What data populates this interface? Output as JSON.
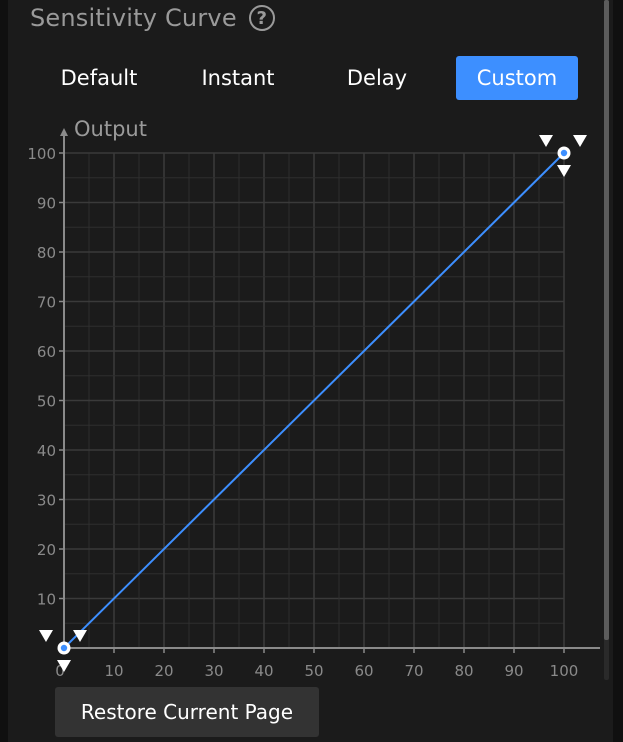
{
  "header": {
    "title": "Sensitivity Curve",
    "help_icon": "question-circle-icon"
  },
  "tabs": [
    {
      "label": "Default",
      "active": false
    },
    {
      "label": "Instant",
      "active": false
    },
    {
      "label": "Delay",
      "active": false
    },
    {
      "label": "Custom",
      "active": true
    }
  ],
  "colors": {
    "accent": "#3d8fff",
    "curve": "#3d8fff",
    "grid": "#3a3a3a",
    "axis": "#8a8a8a"
  },
  "chart_data": {
    "type": "line",
    "title": "",
    "ylabel": "Output",
    "xlabel": "",
    "xlim": [
      0,
      100
    ],
    "ylim": [
      0,
      100
    ],
    "x_ticks": [
      10,
      20,
      30,
      40,
      50,
      60,
      70,
      80,
      90,
      100
    ],
    "y_ticks": [
      10,
      20,
      30,
      40,
      50,
      60,
      70,
      80,
      90,
      100
    ],
    "origin_label": "0",
    "grid": true,
    "series": [
      {
        "x": [
          0,
          100
        ],
        "y": [
          0,
          100
        ]
      }
    ],
    "control_points": [
      {
        "x": 0,
        "y": 0
      },
      {
        "x": 100,
        "y": 100
      }
    ]
  },
  "footer": {
    "restore_label": "Restore Current Page"
  }
}
